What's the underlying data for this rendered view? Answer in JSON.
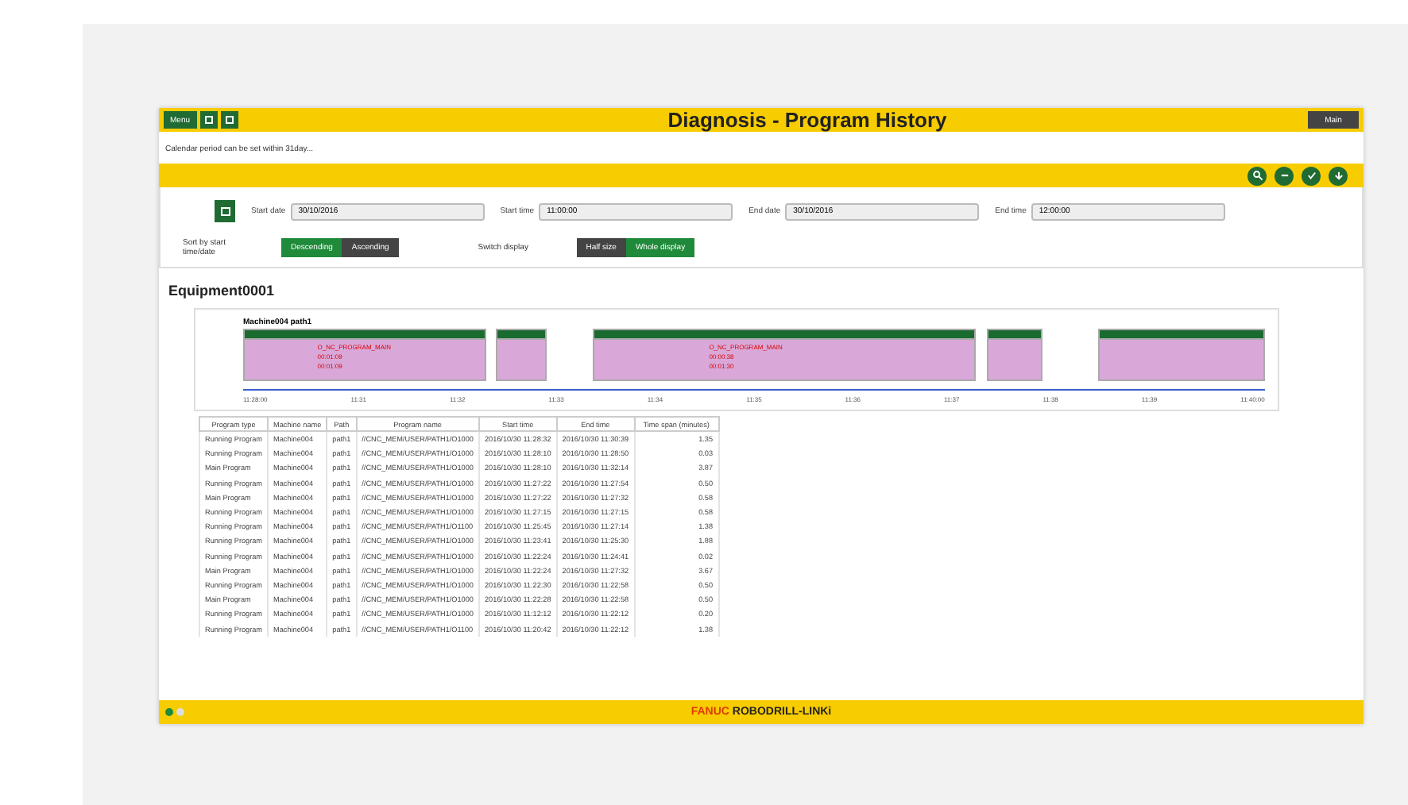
{
  "header": {
    "left_buttons": [
      {
        "kind": "menu",
        "label": "Menu"
      },
      {
        "kind": "icon"
      },
      {
        "kind": "icon"
      }
    ],
    "title": "Diagnosis - Program History",
    "right_button": "Main"
  },
  "notice": "Calendar period can be set within 31day...",
  "toolbar": {
    "buttons": [
      {
        "kind": "search"
      },
      {
        "kind": "minus"
      },
      {
        "kind": "check"
      },
      {
        "kind": "arrow"
      }
    ]
  },
  "filters": {
    "fields": [
      {
        "label": "Start date",
        "value": "30/10/2016"
      },
      {
        "label": "Start time",
        "value": "11:00:00"
      },
      {
        "label": "End date",
        "value": "30/10/2016"
      },
      {
        "label": "End time",
        "value": "12:00:00"
      }
    ],
    "sort": {
      "label": "Sort by start time/date",
      "options": [
        {
          "label": "Descending",
          "selected": true
        },
        {
          "label": "Ascending",
          "selected": false
        }
      ]
    },
    "display": {
      "label": "Switch display",
      "options": [
        {
          "label": "Half size",
          "selected": false
        },
        {
          "label": "Whole display",
          "selected": true
        }
      ]
    }
  },
  "equipment": "Equipment0001",
  "timeline": {
    "title": "Machine004 path1",
    "segments": [
      {
        "kind": "block",
        "notes": [
          "O_NC_PROGRAM_MAIN",
          "00:01:09",
          "00:01:09"
        ]
      },
      {
        "kind": "block"
      },
      {
        "kind": "block",
        "notes": [
          "O_NC_PROGRAM_MAIN",
          "00:00:38",
          "00:01:30"
        ]
      },
      {
        "kind": "block"
      },
      {
        "kind": "block"
      }
    ],
    "ticks": [
      "11:28:00",
      "11:31",
      "11:32",
      "11:33",
      "11:34",
      "11:35",
      "11:36",
      "11:37",
      "11:38",
      "11:39",
      "11:40:00"
    ]
  },
  "table": {
    "columns": [
      "Program type",
      "Machine name",
      "Path",
      "Program name",
      "Start time",
      "End time",
      "Time span (minutes)"
    ],
    "rows": [
      [
        "Running Program",
        "Machine004",
        "path1",
        "//CNC_MEM/USER/PATH1/O1000",
        "2016/10/30 11:28:32",
        "2016/10/30 11:30:39",
        "1.35"
      ],
      [
        "Running Program",
        "Machine004",
        "path1",
        "//CNC_MEM/USER/PATH1/O1000",
        "2016/10/30 11:28:10",
        "2016/10/30 11:28:50",
        "0.03"
      ],
      [
        "Main Program",
        "Machine004",
        "path1",
        "//CNC_MEM/USER/PATH1/O1000",
        "2016/10/30 11:28:10",
        "2016/10/30 11:32:14",
        "3.87"
      ],
      [
        "Running Program",
        "Machine004",
        "path1",
        "//CNC_MEM/USER/PATH1/O1000",
        "2016/10/30 11:27:22",
        "2016/10/30 11:27:54",
        "0.50"
      ],
      [
        "Main Program",
        "Machine004",
        "path1",
        "//CNC_MEM/USER/PATH1/O1000",
        "2016/10/30 11:27:22",
        "2016/10/30 11:27:32",
        "0.58"
      ],
      [
        "Running Program",
        "Machine004",
        "path1",
        "//CNC_MEM/USER/PATH1/O1000",
        "2016/10/30 11:27:15",
        "2016/10/30 11:27:15",
        "0.58"
      ],
      [
        "Running Program",
        "Machine004",
        "path1",
        "//CNC_MEM/USER/PATH1/O1100",
        "2016/10/30 11:25:45",
        "2016/10/30 11:27:14",
        "1.38"
      ],
      [
        "Running Program",
        "Machine004",
        "path1",
        "//CNC_MEM/USER/PATH1/O1000",
        "2016/10/30 11:23:41",
        "2016/10/30 11:25:30",
        "1.88"
      ],
      [
        "Running Program",
        "Machine004",
        "path1",
        "//CNC_MEM/USER/PATH1/O1000",
        "2016/10/30 11:22:24",
        "2016/10/30 11:24:41",
        "0.02"
      ],
      [
        "Main Program",
        "Machine004",
        "path1",
        "//CNC_MEM/USER/PATH1/O1000",
        "2016/10/30 11:22:24",
        "2016/10/30 11:27:32",
        "3.67"
      ],
      [
        "Running Program",
        "Machine004",
        "path1",
        "//CNC_MEM/USER/PATH1/O1000",
        "2016/10/30 11:22:30",
        "2016/10/30 11:22:58",
        "0.50"
      ],
      [
        "Main Program",
        "Machine004",
        "path1",
        "//CNC_MEM/USER/PATH1/O1000",
        "2016/10/30 11:22:28",
        "2016/10/30 11:22:58",
        "0.50"
      ],
      [
        "Running Program",
        "Machine004",
        "path1",
        "//CNC_MEM/USER/PATH1/O1000",
        "2016/10/30 11:12:12",
        "2016/10/30 11:22:12",
        "0.20"
      ],
      [
        "Running Program",
        "Machine004",
        "path1",
        "//CNC_MEM/USER/PATH1/O1100",
        "2016/10/30 11:20:42",
        "2016/10/30 11:22:12",
        "1.38"
      ]
    ]
  },
  "footer": {
    "brand": "FANUC",
    "product": "ROBODRILL-LINKi"
  }
}
